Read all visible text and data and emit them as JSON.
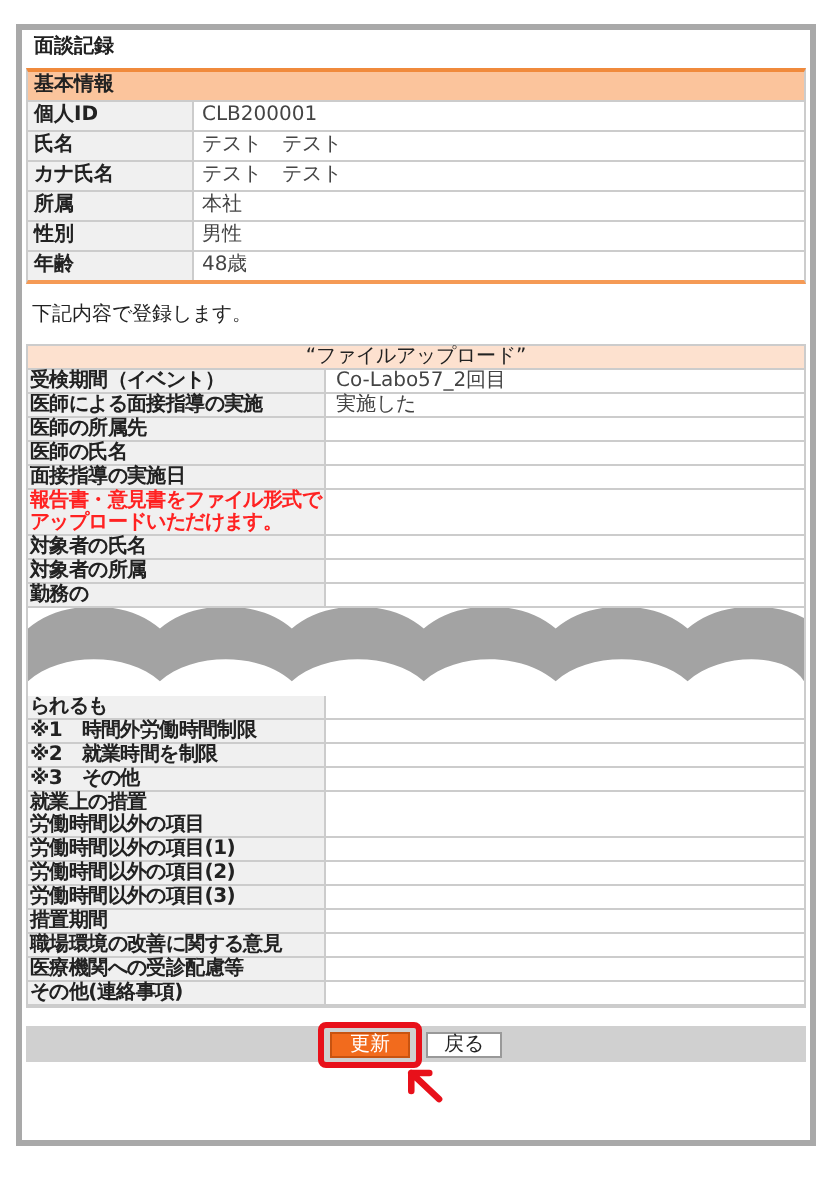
{
  "window": {
    "title": "面談記録"
  },
  "basic_info": {
    "heading": "基本情報",
    "rows": [
      {
        "label": "個人ID",
        "value": "CLB200001"
      },
      {
        "label": "氏名",
        "value": "テスト　テスト"
      },
      {
        "label": "カナ氏名",
        "value": "テスト　テスト"
      },
      {
        "label": "所属",
        "value": "本社"
      },
      {
        "label": "性別",
        "value": "男性"
      },
      {
        "label": "年齢",
        "value": "48歳"
      }
    ]
  },
  "message": "下記内容で登録します。",
  "upload_section": {
    "heading": "“ファイルアップロード”",
    "rows": [
      {
        "kind": "field",
        "label": "受検期間（イベント）",
        "value": "Co-Labo57_2回目"
      },
      {
        "kind": "field",
        "label": "医師による面接指導の実施",
        "value": "実施した"
      },
      {
        "kind": "field",
        "label": "医師の所属先"
      },
      {
        "kind": "field",
        "label": "医師の氏名"
      },
      {
        "kind": "field",
        "label": "面接指導の実施日"
      },
      {
        "kind": "note",
        "label": "報告書・意見書をファイル形式でアップロードいただけます。"
      },
      {
        "kind": "field",
        "label": "対象者の氏名"
      },
      {
        "kind": "field",
        "label": "対象者の所属"
      },
      {
        "kind": "field",
        "label": "勤務の"
      },
      {
        "kind": "break"
      },
      {
        "kind": "field",
        "label": "られるも"
      },
      {
        "kind": "field",
        "label": "※1　時間外労働時間制限"
      },
      {
        "kind": "field",
        "label": "※2　就業時間を制限"
      },
      {
        "kind": "field",
        "label": "※3　その他"
      },
      {
        "kind": "field",
        "label": "就業上の措置",
        "sublabel": "労働時間以外の項目"
      },
      {
        "kind": "field",
        "label": "労働時間以外の項目(1)"
      },
      {
        "kind": "field",
        "label": "労働時間以外の項目(2)"
      },
      {
        "kind": "field",
        "label": "労働時間以外の項目(3)"
      },
      {
        "kind": "field",
        "label": "措置期間"
      },
      {
        "kind": "field",
        "label": "職場環境の改善に関する意見"
      },
      {
        "kind": "field",
        "label": "医療機関への受診配慮等"
      },
      {
        "kind": "field",
        "label": "その他(連絡事項)"
      }
    ]
  },
  "buttons": [
    {
      "label": "更新",
      "kind": "primary",
      "highlighted": true
    },
    {
      "label": "戻る",
      "kind": "secondary",
      "highlighted": false
    }
  ]
}
